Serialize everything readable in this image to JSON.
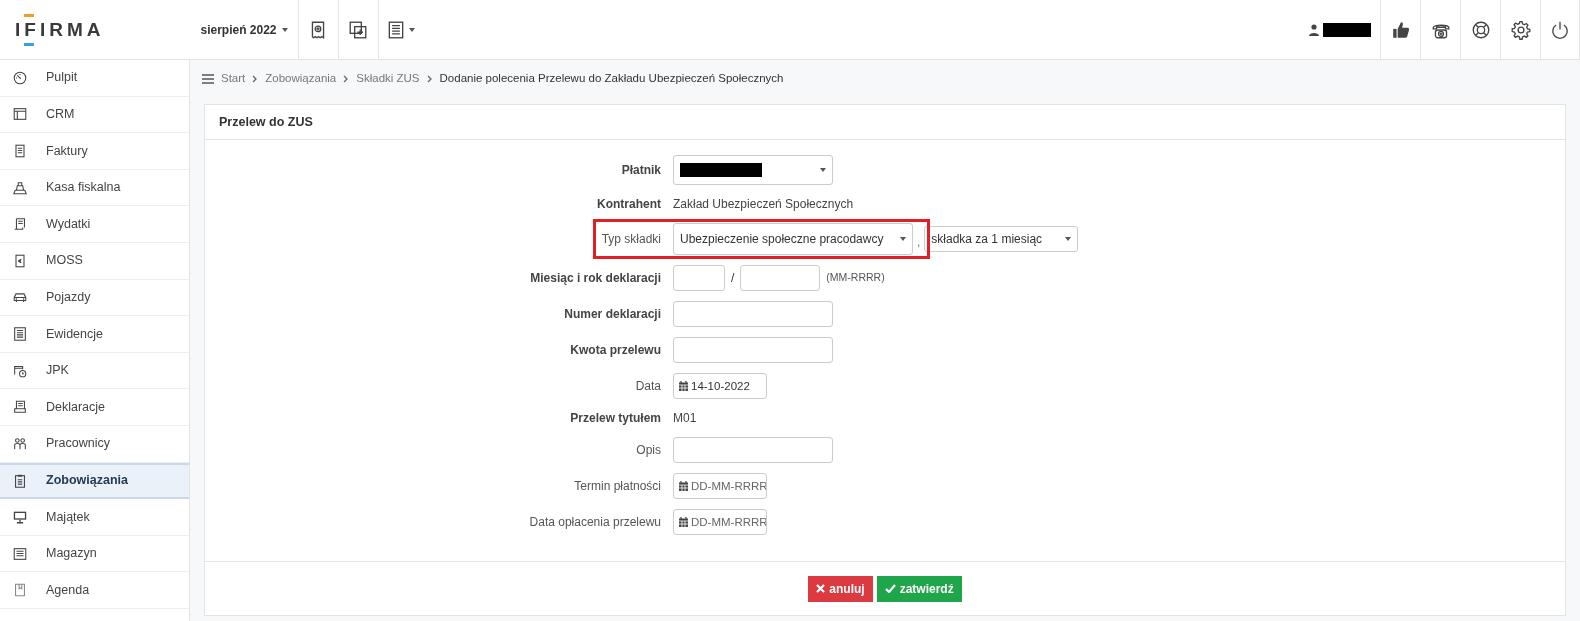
{
  "header": {
    "logo": "IFIRMA",
    "period": "sierpień 2022",
    "tools": [
      {
        "dropdown": false
      },
      {
        "dropdown": false
      },
      {
        "dropdown": true
      }
    ],
    "user": {
      "redacted": true
    }
  },
  "sidebar": {
    "items": [
      {
        "label": "Pulpit",
        "selected": false
      },
      {
        "label": "CRM",
        "selected": false
      },
      {
        "label": "Faktury",
        "selected": false
      },
      {
        "label": "Kasa fiskalna",
        "selected": false
      },
      {
        "label": "Wydatki",
        "selected": false
      },
      {
        "label": "MOSS",
        "selected": false
      },
      {
        "label": "Pojazdy",
        "selected": false
      },
      {
        "label": "Ewidencje",
        "selected": false
      },
      {
        "label": "JPK",
        "selected": false
      },
      {
        "label": "Deklaracje",
        "selected": false
      },
      {
        "label": "Pracownicy",
        "selected": false
      },
      {
        "label": "Zobowiązania",
        "selected": true
      },
      {
        "label": "Majątek",
        "selected": false
      },
      {
        "label": "Magazyn",
        "selected": false
      },
      {
        "label": "Agenda",
        "selected": false
      }
    ]
  },
  "breadcrumb": [
    {
      "label": "Start",
      "current": false
    },
    {
      "label": "Zobowiązania",
      "current": false
    },
    {
      "label": "Składki ZUS",
      "current": false
    },
    {
      "label": "Dodanie polecenia Przelewu do Zakładu Ubezpieczeń Społecznych",
      "current": true
    }
  ],
  "form": {
    "title": "Przelew do ZUS",
    "rows": [
      {
        "kind": "select",
        "label": "Płatnik",
        "bold": true,
        "redacted": true
      },
      {
        "kind": "static",
        "label": "Kontrahent",
        "bold": true,
        "value": "Zakład Ubezpieczeń Społecznych"
      },
      {
        "kind": "double-select",
        "label": "Typ składki",
        "bold": false,
        "highlighted": true,
        "value": "Ubezpieczenie społeczne pracodawcy",
        "separator": ",",
        "value_2": "składka za 1 miesiąc"
      },
      {
        "kind": "pair",
        "label": "Miesiąc i rok deklaracji",
        "bold": true,
        "separator": "/",
        "hint": "(MM-RRRR)"
      },
      {
        "kind": "text",
        "label": "Numer deklaracji",
        "bold": true
      },
      {
        "kind": "text",
        "label": "Kwota przelewu",
        "bold": true
      },
      {
        "kind": "date",
        "label": "Data",
        "bold": false,
        "value": "14-10-2022"
      },
      {
        "kind": "static",
        "label": "Przelew tytułem",
        "bold": true,
        "value": "M01"
      },
      {
        "kind": "text",
        "label": "Opis",
        "bold": false
      },
      {
        "kind": "date",
        "label": "Termin płatności",
        "bold": false,
        "placeholder": "DD-MM-RRRR"
      },
      {
        "kind": "date",
        "label": "Data opłacenia przelewu",
        "bold": false,
        "placeholder": "DD-MM-RRRR"
      }
    ],
    "buttons": [
      {
        "label": "anuluj",
        "kind": "cancel"
      },
      {
        "label": "zatwierdź",
        "kind": "submit"
      }
    ]
  }
}
